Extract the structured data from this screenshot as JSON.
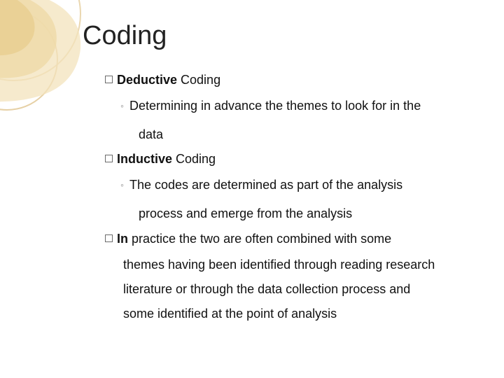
{
  "title": "Coding",
  "items": [
    {
      "prefix_bold": "Deductive",
      "suffix": " Coding",
      "sub": {
        "line1": "Determining in advance the themes to look for in the",
        "line2": "data"
      }
    },
    {
      "prefix_bold": "Inductive",
      "suffix": " Coding",
      "sub": {
        "line1": "The codes are determined as part of the analysis",
        "line2": "process and emerge from the analysis"
      }
    },
    {
      "prefix_bold": "In",
      "suffix": " practice the two are often combined with some",
      "cont": [
        "themes having been identified through reading research",
        "literature or through the data collection process and",
        "some identified at the point of analysis"
      ]
    }
  ],
  "sub_marker": "◦"
}
